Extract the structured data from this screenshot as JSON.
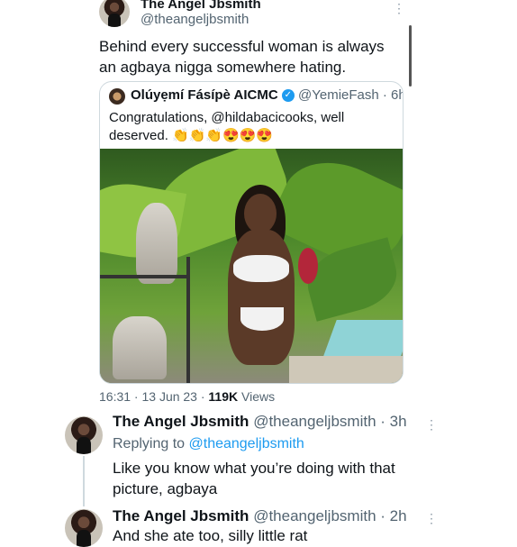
{
  "main_tweet": {
    "name": "The Angel Jbsmith",
    "handle": "@theangeljbsmith",
    "text_line1": "Behind every successful woman is always",
    "text_line2": "an agbaya nigga somewhere hating.",
    "more_icon": "ellipsis-vertical-icon",
    "meta_time": "16:31 · 13 Jun 23 · ",
    "meta_views_count": "119K",
    "meta_views_label": " Views"
  },
  "quoted_tweet": {
    "name": "Olúyẹmí Fásípè AICMC",
    "verified_icon": "verified-badge-icon",
    "handle": "@YemieFash",
    "time": " · 6h",
    "text_line1": "Congratulations, @hildabacicooks, well",
    "text_line2": "deserved. 👏👏👏😍😍😍"
  },
  "replies": [
    {
      "name": "The Angel Jbsmith",
      "handle": "@theangeljbsmith",
      "time": " · 3h",
      "replying_label": "Replying to ",
      "replying_handle": "@theangeljbsmith",
      "text_line1": "Like you know what you’re doing with that",
      "text_line2": "picture, agbaya"
    },
    {
      "name": "The Angel Jbsmith",
      "handle": "@theangeljbsmith",
      "time": " · 2h",
      "text_line1": "And she ate too, silly little rat"
    }
  ],
  "colors": {
    "text": "#0f1419",
    "secondary": "#536471",
    "link": "#1d9bf0",
    "border": "#cfd9de"
  }
}
